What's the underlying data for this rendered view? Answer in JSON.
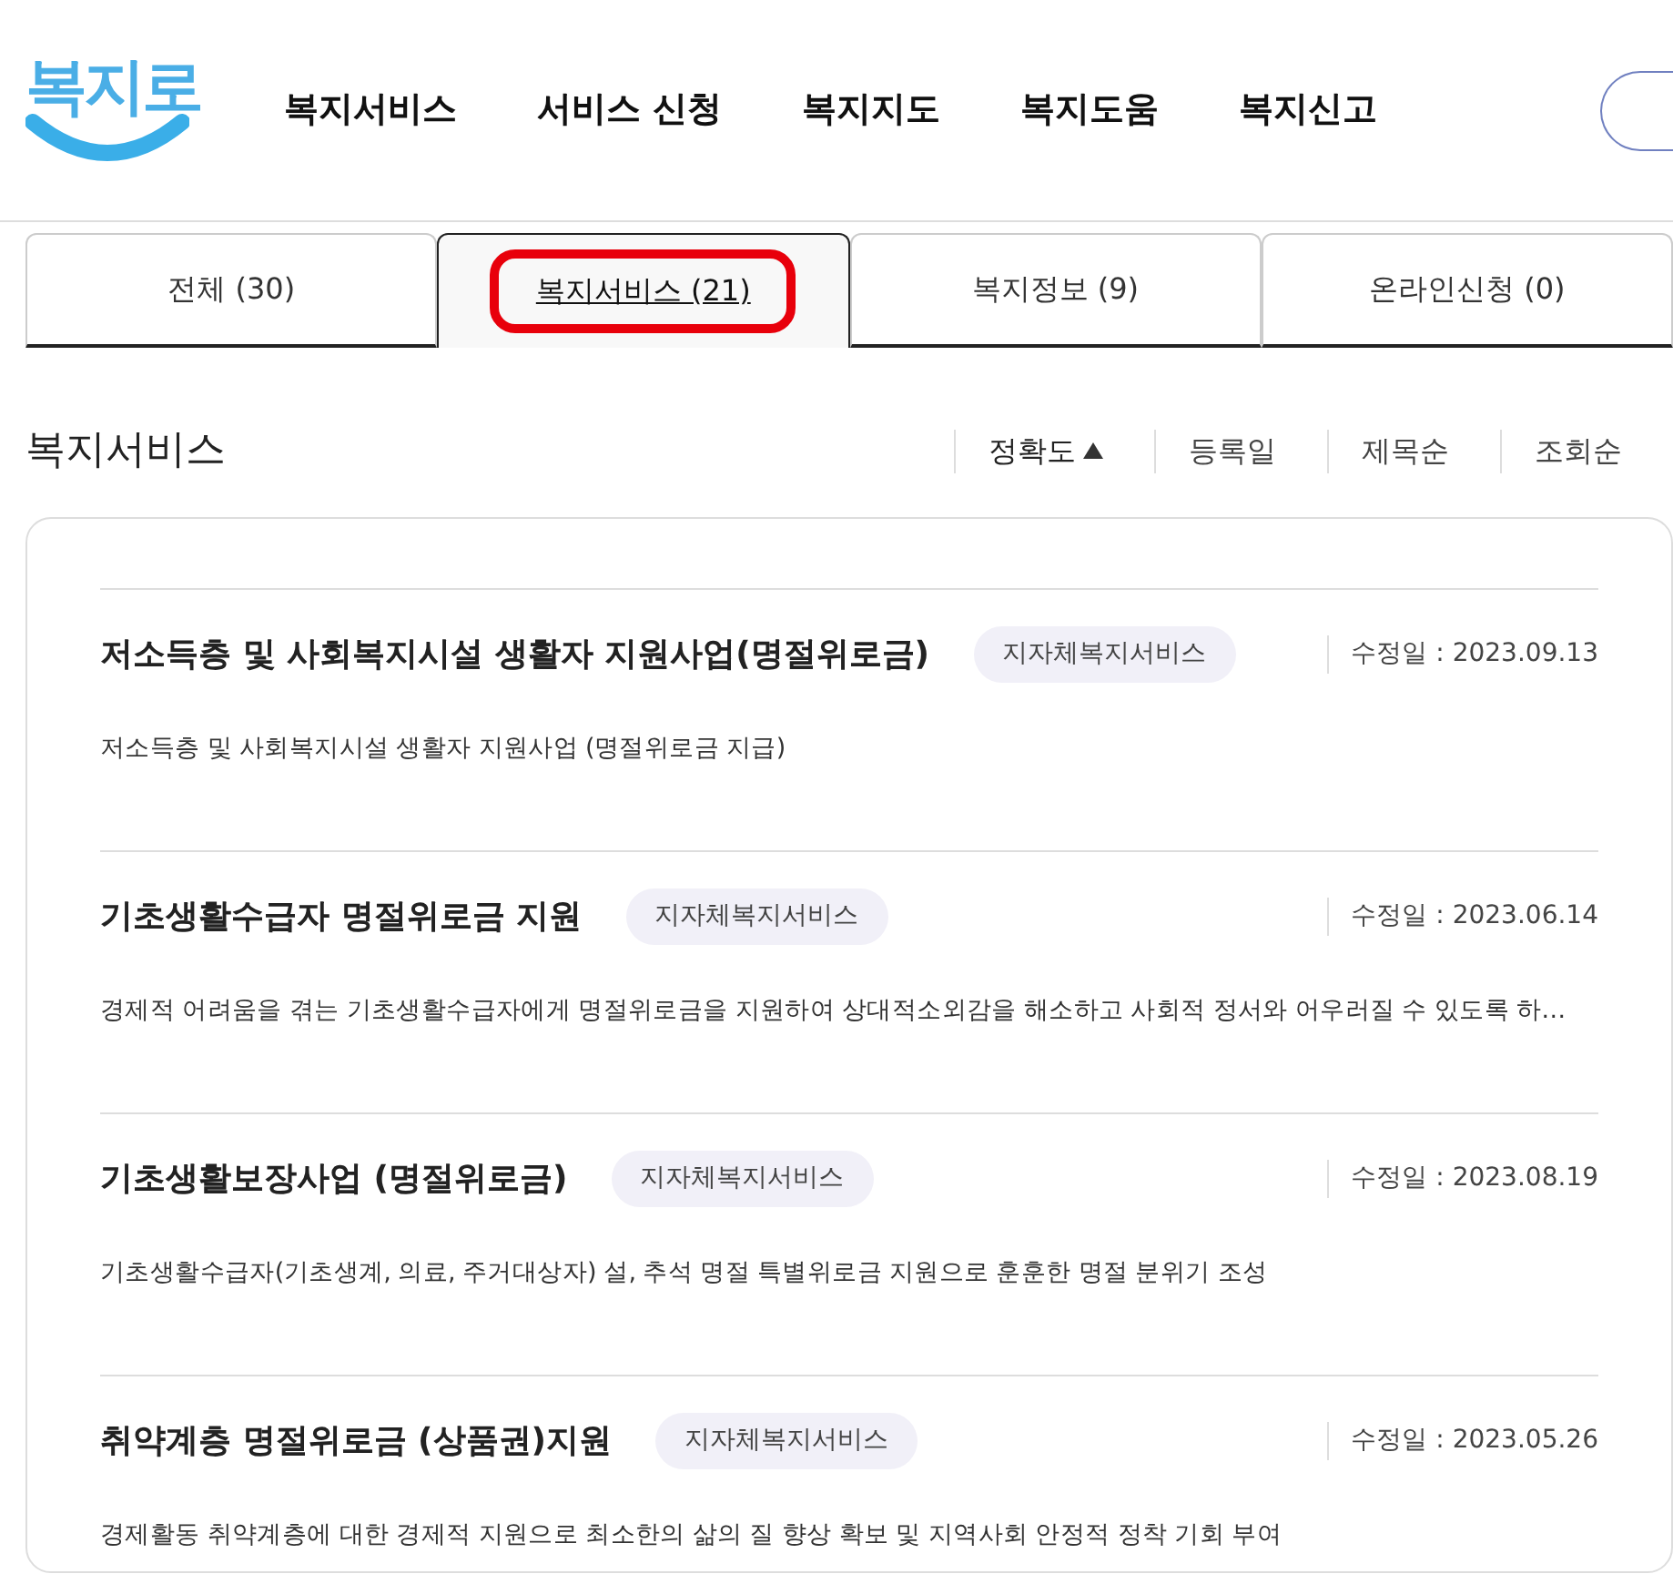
{
  "logo": {
    "text": "복지로"
  },
  "nav": [
    {
      "label": "복지서비스"
    },
    {
      "label": "서비스 신청"
    },
    {
      "label": "복지지도"
    },
    {
      "label": "복지도움"
    },
    {
      "label": "복지신고"
    }
  ],
  "tabs": [
    {
      "label": "전체  (30)",
      "selected": false,
      "highlighted": false
    },
    {
      "label": "복지서비스 (21)",
      "selected": true,
      "highlighted": true
    },
    {
      "label": "복지정보 (9)",
      "selected": false,
      "highlighted": false
    },
    {
      "label": "온라인신청 (0)",
      "selected": false,
      "highlighted": false
    }
  ],
  "section": {
    "title": "복지서비스"
  },
  "sort": [
    {
      "label": "정확도",
      "selected": true
    },
    {
      "label": "등록일",
      "selected": false
    },
    {
      "label": "제목순",
      "selected": false
    },
    {
      "label": "조회순",
      "selected": false
    }
  ],
  "results": [
    {
      "title": "저소득층 및 사회복지시설 생활자 지원사업(명절위로금)",
      "tag": "지자체복지서비스",
      "date_label": "수정일 :",
      "date": "2023.09.13",
      "description": "저소득층 및 사회복지시설 생활자 지원사업 (명절위로금 지급)"
    },
    {
      "title": "기초생활수급자 명절위로금 지원",
      "tag": "지자체복지서비스",
      "date_label": "수정일 :",
      "date": "2023.06.14",
      "description": "경제적 어려움을 겪는 기초생활수급자에게 명절위로금을 지원하여 상대적소외감을 해소하고 사회적 정서와 어우러질 수 있도록 하…"
    },
    {
      "title": "기초생활보장사업 (명절위로금)",
      "tag": "지자체복지서비스",
      "date_label": "수정일 :",
      "date": "2023.08.19",
      "description": "기초생활수급자(기초생계, 의료, 주거대상자) 설, 추석 명절 특별위로금 지원으로 훈훈한 명절 분위기 조성"
    },
    {
      "title": "취약계층 명절위로금 (상품권)지원",
      "tag": "지자체복지서비스",
      "date_label": "수정일 :",
      "date": "2023.05.26",
      "description": "경제활동 취약계층에 대한 경제적 지원으로 최소한의 삶의 질 향상 확보 및 지역사회 안정적 정착 기회 부여"
    }
  ]
}
